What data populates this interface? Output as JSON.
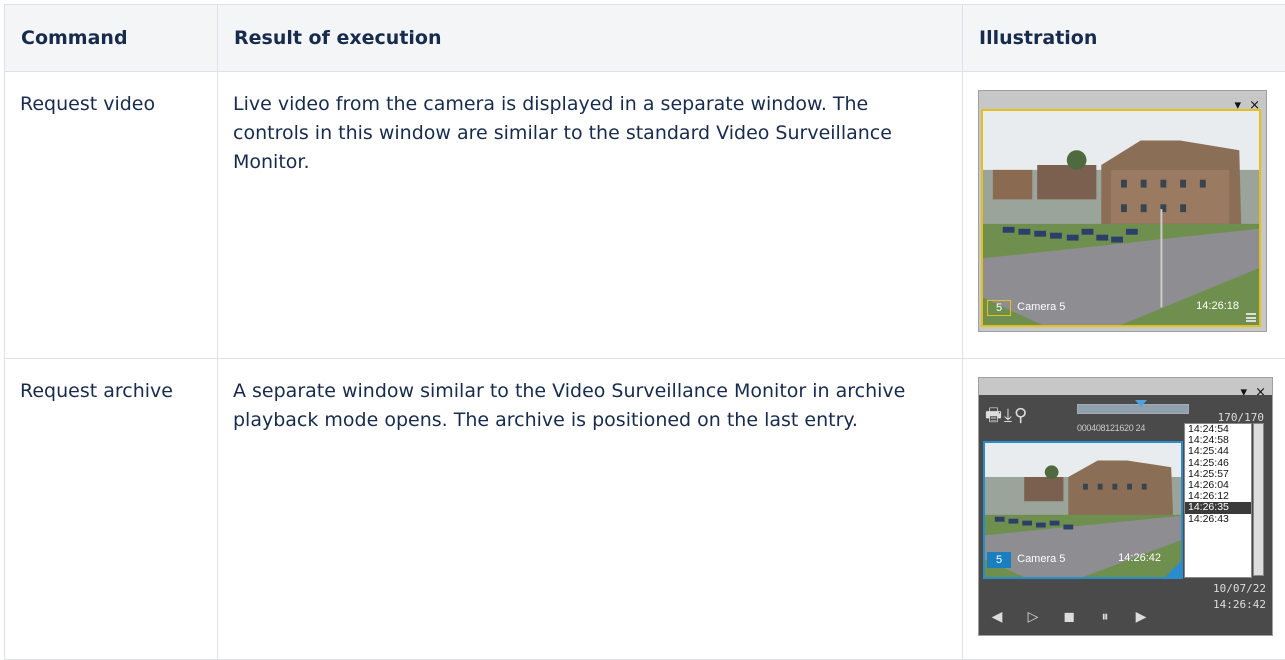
{
  "headers": {
    "command": "Command",
    "result": "Result of execution",
    "illustration": "Illustration"
  },
  "rows": [
    {
      "command": "Request video",
      "result": "Live video from the camera is displayed in a separate window. The controls in this window are similar to the standard Video Surveillance Monitor.",
      "illustration": {
        "window_controls": "▾ ×",
        "camera_number": "5",
        "camera_name": "Camera 5",
        "time": "14:26:18",
        "accent_color": "#e4c11a"
      }
    },
    {
      "command": "Request archive",
      "result": "A separate window similar to the Video Surveillance Monitor in archive playback mode opens. The archive is positioned on the last entry.",
      "illustration": {
        "window_controls": "▾ ×",
        "counter": "170/170",
        "timeline_ticks": "000408121620 24",
        "times": [
          "14:24:54",
          "14:24:58",
          "14:25:44",
          "14:25:46",
          "14:25:57",
          "14:26:04",
          "14:26:12",
          "14:26:35",
          "14:26:43"
        ],
        "selected_time": "14:26:35",
        "camera_number": "5",
        "camera_name": "Camera 5",
        "time": "14:26:42",
        "date": "10/07/22",
        "date_time": "14:26:42",
        "accent_color": "#2b8ccc",
        "icons": [
          "print-icon",
          "export-icon",
          "search-icon",
          "rewind-icon",
          "play-icon",
          "stop-icon",
          "pause-icon",
          "forward-icon"
        ]
      }
    }
  ]
}
